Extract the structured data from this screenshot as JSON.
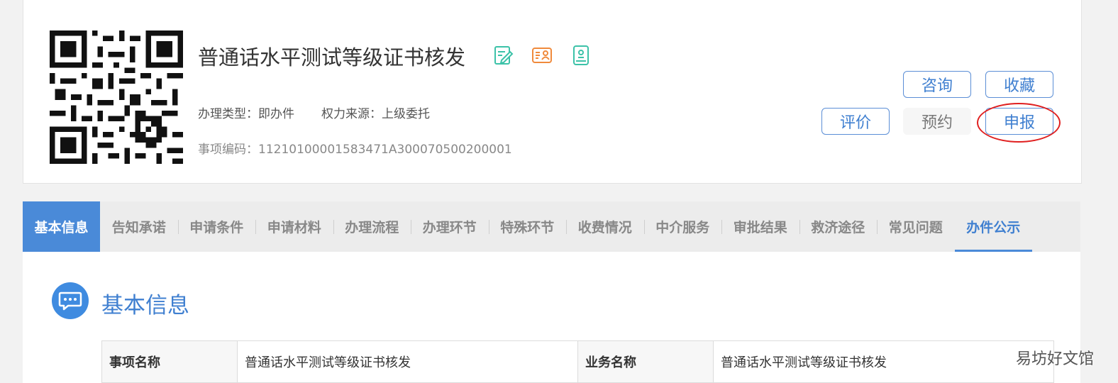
{
  "header": {
    "title": "普通话水平测试等级证书核发",
    "type_label": "办理类型：即办件",
    "source_label": "权力来源：上级委托",
    "code_label": "事项编码：11210100001583471A300070500200001",
    "icons": [
      "edit-form-icon",
      "id-card-icon",
      "tablet-icon"
    ]
  },
  "buttons": {
    "consult": "咨询",
    "favorite": "收藏",
    "rate": "评价",
    "appointment": "预约",
    "apply": "申报"
  },
  "tabs": [
    {
      "label": "基本信息"
    },
    {
      "label": "告知承诺"
    },
    {
      "label": "申请条件"
    },
    {
      "label": "申请材料"
    },
    {
      "label": "办理流程"
    },
    {
      "label": "办理环节"
    },
    {
      "label": "特殊环节"
    },
    {
      "label": "收费情况"
    },
    {
      "label": "中介服务"
    },
    {
      "label": "审批结果"
    },
    {
      "label": "救济途径"
    },
    {
      "label": "常见问题"
    },
    {
      "label": "办件公示"
    }
  ],
  "section": {
    "title": "基本信息"
  },
  "table": {
    "row1": {
      "label1": "事项名称",
      "value1": "普通话水平测试等级证书核发",
      "label2": "业务名称",
      "value2": "普通话水平测试等级证书核发"
    }
  },
  "watermark": "易坊好文馆",
  "colors": {
    "accent": "#4a8ad8",
    "highlight": "#e02020"
  }
}
